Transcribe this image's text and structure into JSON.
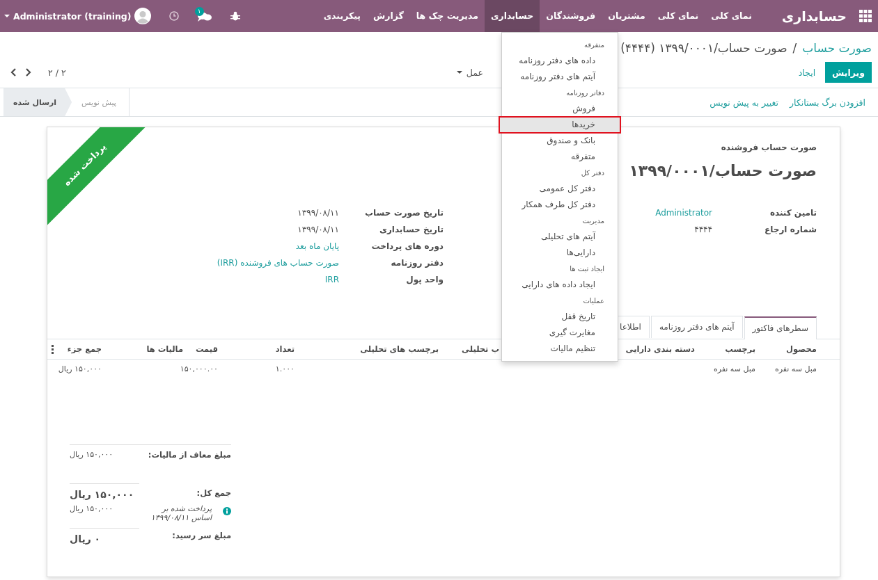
{
  "navbar": {
    "brand": "حسابداری",
    "menu": [
      {
        "label": "نمای کلی",
        "selected": false
      },
      {
        "label": "نمای کلی",
        "selected": false
      },
      {
        "label": "مشتریان",
        "selected": false
      },
      {
        "label": "فروشندگان",
        "selected": false
      },
      {
        "label": "حسابداری",
        "selected": true
      },
      {
        "label": "مدیریت چک ها",
        "selected": false
      },
      {
        "label": "گزارش",
        "selected": false
      },
      {
        "label": "پیکربندی",
        "selected": false
      }
    ],
    "chat_badge": "۱",
    "user": "Administrator (training)"
  },
  "dropdown_menu": [
    {
      "kind": "header",
      "label": "متفرقه"
    },
    {
      "kind": "item",
      "label": "داده های دفتر روزنامه",
      "selected": false
    },
    {
      "kind": "item",
      "label": "آیتم های دفتر روزنامه",
      "selected": false
    },
    {
      "kind": "header",
      "label": "دفاتر روزنامه"
    },
    {
      "kind": "item",
      "label": "فروش",
      "selected": false
    },
    {
      "kind": "item",
      "label": "خریدها",
      "selected": true
    },
    {
      "kind": "item",
      "label": "بانک و صندوق",
      "selected": false
    },
    {
      "kind": "item",
      "label": "متفرقه",
      "selected": false
    },
    {
      "kind": "header",
      "label": "دفتر کل"
    },
    {
      "kind": "item",
      "label": "دفتر کل عمومی",
      "selected": false
    },
    {
      "kind": "item",
      "label": "دفتر کل طرف همکار",
      "selected": false
    },
    {
      "kind": "header",
      "label": "مدیریت"
    },
    {
      "kind": "item",
      "label": "آیتم های تحلیلی",
      "selected": false
    },
    {
      "kind": "item",
      "label": "دارایی‌ها",
      "selected": false
    },
    {
      "kind": "header",
      "label": "ایجاد ثبت ها"
    },
    {
      "kind": "item",
      "label": "ایجاد داده های دارایی",
      "selected": false
    },
    {
      "kind": "header",
      "label": "عملیات"
    },
    {
      "kind": "item",
      "label": "تاریخ قفل",
      "selected": false
    },
    {
      "kind": "item",
      "label": "مغایرت گیری",
      "selected": false
    },
    {
      "kind": "item",
      "label": "تنظیم مالیات",
      "selected": false
    }
  ],
  "breadcrumb": {
    "parent": "صورت حساب",
    "separator": "/",
    "current": "صورت حساب/۱۳۹۹/۰۰۰۱ (۴۴۴۴)"
  },
  "buttons": {
    "edit": "ویرایش",
    "create": "ایجاد"
  },
  "action_menu": "عمل",
  "pager": "۲ / ۲",
  "status_buttons": [
    "افزودن برگ بستانکار",
    "تغییر به پیش نویس"
  ],
  "stages": [
    {
      "label": "پیش نویس",
      "selected": false
    },
    {
      "label": "ارسال شده",
      "selected": true
    }
  ],
  "ribbon": "پرداخت شده",
  "document": {
    "type": "صورت حساب فروشنده",
    "title": "صورت حساب/۱۳۹۹/۰۰۰۱"
  },
  "fields_right": [
    {
      "label": "تامین کننده",
      "value": "Administrator",
      "kind": "link"
    },
    {
      "label": "شماره ارجاع",
      "value": "۴۴۴۴",
      "kind": "text"
    }
  ],
  "fields_left": [
    {
      "label": "تاریخ صورت حساب",
      "value": "۱۳۹۹/۰۸/۱۱",
      "kind": "text"
    },
    {
      "label": "تاریخ حسابداری",
      "value": "۱۳۹۹/۰۸/۱۱",
      "kind": "text"
    },
    {
      "label": "دوره های پرداخت",
      "value": "پایان ماه بعد",
      "kind": "link"
    },
    {
      "label": "دفتر روزنامه",
      "value": "صورت حساب های فروشنده (IRR)",
      "kind": "link"
    },
    {
      "label": "واحد پول",
      "value": "IRR",
      "kind": "link"
    }
  ],
  "tabs": [
    {
      "label": "سطرهای فاکتور",
      "selected": true
    },
    {
      "label": "آیتم های دفتر روزنامه",
      "selected": false
    },
    {
      "label": "اطلاعا",
      "selected": false
    }
  ],
  "table": {
    "columns": [
      "محصول",
      "برچسب",
      "دسته بندی دارایی",
      "ب تحلیلی",
      "برچسب های تحلیلی",
      "تعداد",
      "قیمت",
      "مالیات ها",
      "جمع جزء"
    ],
    "rows": [
      {
        "product": "مبل سه نفره",
        "label": "مبل سه نفره",
        "quantity": "۱.۰۰۰",
        "price": "۱۵۰,۰۰۰.۰۰",
        "subtotal": "۱۵۰,۰۰۰ ریال"
      }
    ]
  },
  "totals": {
    "untaxed": {
      "label": "مبلغ معاف از مالیات:",
      "value": "۱۵۰,۰۰۰ ریال"
    },
    "total": {
      "label": "جمع کل:",
      "value": "۱۵۰,۰۰۰ ریال"
    },
    "payment": {
      "text": "پرداخت شده بر اساس ۱۳۹۹/۰۸/۱۱",
      "amount": "۱۵۰,۰۰۰ ریال"
    },
    "due": {
      "label": "مبلغ سر رسید:",
      "value": "۰ ریال"
    }
  }
}
